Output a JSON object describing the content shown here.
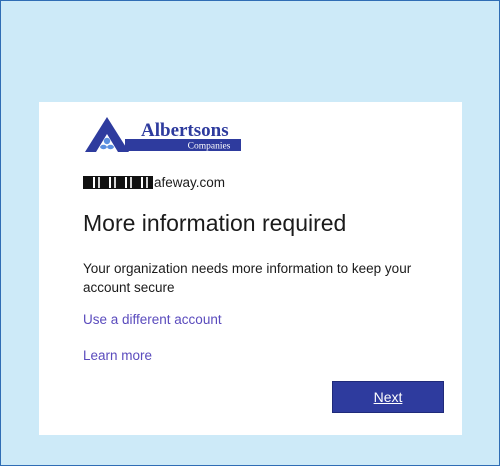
{
  "logo": {
    "brand_name": "Albertsons",
    "brand_sub": "Companies",
    "icon": "albertsons-logo-icon",
    "colors": {
      "primary": "#2e3b9e",
      "accent": "#5a8fe0"
    }
  },
  "account": {
    "email_suffix": "afeway.com"
  },
  "title": "More information required",
  "description": "Your organization needs more information to keep your account secure",
  "links": {
    "different_account": "Use a different account",
    "learn_more": "Learn more"
  },
  "next_button": "Next",
  "colors": {
    "background": "#cdeaf8",
    "link": "#5a4bbd",
    "button": "#2e3b9e"
  }
}
